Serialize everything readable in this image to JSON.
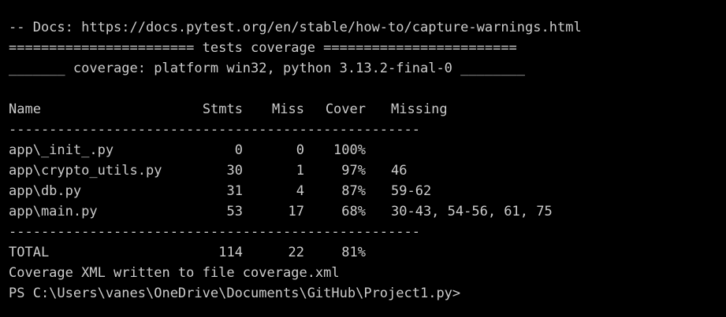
{
  "terminal": {
    "docs_line": "-- Docs: https://docs.pytest.org/en/stable/how-to/capture-warnings.html",
    "separator_line": "======================= tests coverage ========================",
    "platform_line": "_______ coverage: platform win32, python 3.13.2-final-0 ________",
    "table": {
      "headers": {
        "name": "Name",
        "stmts": "Stmts",
        "miss": "Miss",
        "cover": "Cover",
        "missing": "Missing"
      },
      "divider": "---------------------------------------------------",
      "rows": [
        {
          "name": "app\\_init_.py",
          "stmts": "0",
          "miss": "0",
          "cover": "100%",
          "missing": ""
        },
        {
          "name": "app\\crypto_utils.py",
          "stmts": "30",
          "miss": "1",
          "cover": "97%",
          "missing": "46"
        },
        {
          "name": "app\\db.py",
          "stmts": "31",
          "miss": "4",
          "cover": "87%",
          "missing": "59-62"
        },
        {
          "name": "app\\main.py",
          "stmts": "53",
          "miss": "17",
          "cover": "68%",
          "missing": "30-43, 54-56, 61, 75"
        }
      ],
      "total": {
        "name": "TOTAL",
        "stmts": "114",
        "miss": "22",
        "cover": "81%",
        "missing": ""
      }
    },
    "xml_line": "Coverage XML written to file coverage.xml",
    "prompt": "PS C:\\Users\\vanes\\OneDrive\\Documents\\GitHub\\Project1.py>"
  },
  "colors": {
    "background": "#000000",
    "text": "#cccccc"
  }
}
